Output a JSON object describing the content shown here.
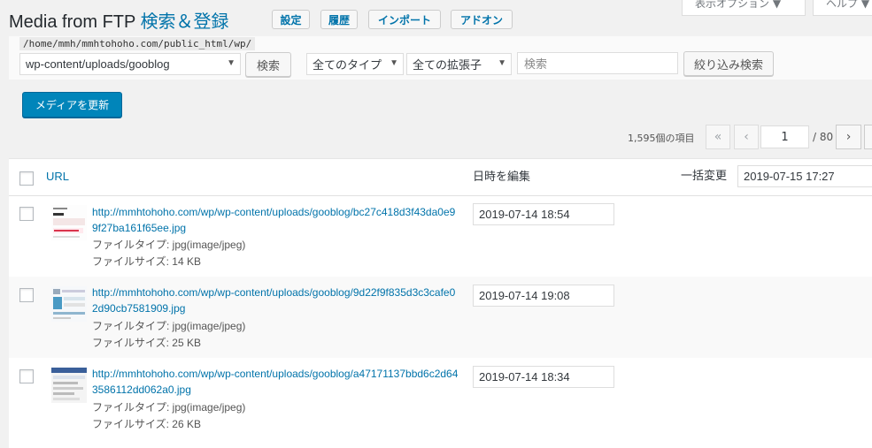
{
  "header": {
    "title": "Media from FTP",
    "subtitle": "検索＆登録",
    "tabs": [
      "設定",
      "履歴",
      "インポート",
      "アドオン"
    ],
    "screen_options": "表示オプション ▼",
    "help": "ヘルプ ▼"
  },
  "filter": {
    "path": "/home/mmh/mmhtohoho.com/public_html/wp/",
    "folder": "wp-content/uploads/gooblog",
    "search_button": "検索",
    "type_select": "全てのタイプ",
    "ext_select": "全ての拡張子",
    "search_placeholder": "検索",
    "filter_button": "絞り込み検索"
  },
  "update_button": "メディアを更新",
  "pagination": {
    "item_count": "1,595個の項目",
    "first": "«",
    "prev": "‹",
    "current_page": "1",
    "total": "/ 80",
    "next": "›"
  },
  "table": {
    "col_url": "URL",
    "col_date": "日時を編集",
    "col_bulk": "一括変更",
    "bulk_value": "2019-07-15 17:27",
    "rows": [
      {
        "url": "http://mmhtohoho.com/wp/wp-content/uploads/gooblog/bc27c418d3f43da0e99f27ba161f65ee.jpg",
        "type": "ファイルタイプ: jpg(image/jpeg)",
        "size": "ファイルサイズ: 14 KB",
        "date": "2019-07-14 18:54"
      },
      {
        "url": "http://mmhtohoho.com/wp/wp-content/uploads/gooblog/9d22f9f835d3c3cafe02d90cb7581909.jpg",
        "type": "ファイルタイプ: jpg(image/jpeg)",
        "size": "ファイルサイズ: 25 KB",
        "date": "2019-07-14 19:08"
      },
      {
        "url": "http://mmhtohoho.com/wp/wp-content/uploads/gooblog/a47171137bbd6c2d643586112dd062a0.jpg",
        "type": "ファイルタイプ: jpg(image/jpeg)",
        "size": "ファイルサイズ: 26 KB",
        "date": "2019-07-14 18:34"
      }
    ]
  },
  "colors": {
    "accent": "#0073aa",
    "primary": "#0085ba"
  }
}
